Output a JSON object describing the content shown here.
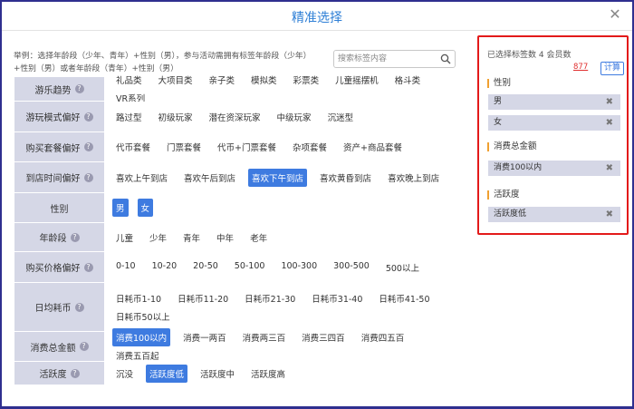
{
  "dialog": {
    "title": "精准选择",
    "close_icon": "close-icon"
  },
  "example_text": "举例：选择年龄段（少年、青年）+性别（男），参与活动需拥有标签年龄段（少年）+性别（男）或者年龄段（青年）+性别（男）",
  "search": {
    "placeholder": "搜索标签内容",
    "value": ""
  },
  "rows": [
    {
      "label": "游乐趋势",
      "options": [
        "礼品类",
        "大项目类",
        "亲子类",
        "模拟类",
        "彩票类",
        "儿童摇摆机",
        "格斗类",
        "VR系列"
      ],
      "selected": []
    },
    {
      "label": "游玩模式偏好",
      "options": [
        "路过型",
        "初级玩家",
        "潜在资深玩家",
        "中级玩家",
        "沉迷型"
      ],
      "selected": []
    },
    {
      "label": "购买套餐偏好",
      "options": [
        "代币套餐",
        "门票套餐",
        "代币+门票套餐",
        "杂项套餐",
        "资产+商品套餐"
      ],
      "selected": []
    },
    {
      "label": "到店时间偏好",
      "options": [
        "喜欢上午到店",
        "喜欢午后到店",
        "喜欢下午到店",
        "喜欢黄昏到店",
        "喜欢晚上到店"
      ],
      "selected": [
        "喜欢下午到店"
      ]
    },
    {
      "label": "性别",
      "options": [
        "男",
        "女"
      ],
      "selected": [
        "男",
        "女"
      ]
    },
    {
      "label": "年龄段",
      "options": [
        "儿童",
        "少年",
        "青年",
        "中年",
        "老年"
      ],
      "selected": []
    },
    {
      "label": "购买价格偏好",
      "options": [
        "0-10",
        "10-20",
        "20-50",
        "50-100",
        "100-300",
        "300-500",
        "500以上"
      ],
      "selected": []
    },
    {
      "label": "日均耗币",
      "options": [
        "日耗币1-10",
        "日耗币11-20",
        "日耗币21-30",
        "日耗币31-40",
        "日耗币41-50",
        "日耗币50以上"
      ],
      "selected": []
    },
    {
      "label": "消费总金额",
      "options": [
        "消费100以内",
        "消费一两百",
        "消费两三百",
        "消费三四百",
        "消费四五百",
        "消费五百起"
      ],
      "selected": [
        "消费100以内"
      ]
    },
    {
      "label": "活跃度",
      "options": [
        "沉没",
        "活跃度低",
        "活跃度中",
        "活跃度高"
      ],
      "selected": [
        "活跃度低"
      ]
    }
  ],
  "panel": {
    "header": "已选择标签数 4 会员数",
    "member_count": "877",
    "calc_label": "计算",
    "groups": [
      {
        "title": "性别",
        "tags": [
          "男",
          "女"
        ]
      },
      {
        "title": "消费总金额",
        "tags": [
          "消费100以内"
        ]
      },
      {
        "title": "活跃度",
        "tags": [
          "活跃度低"
        ]
      }
    ]
  },
  "colors": {
    "accent": "#3e7be0",
    "title": "#2e7fd6",
    "label_bg": "#d5d7e6",
    "highlight_border": "#e31a1a",
    "count": "#e03030"
  }
}
